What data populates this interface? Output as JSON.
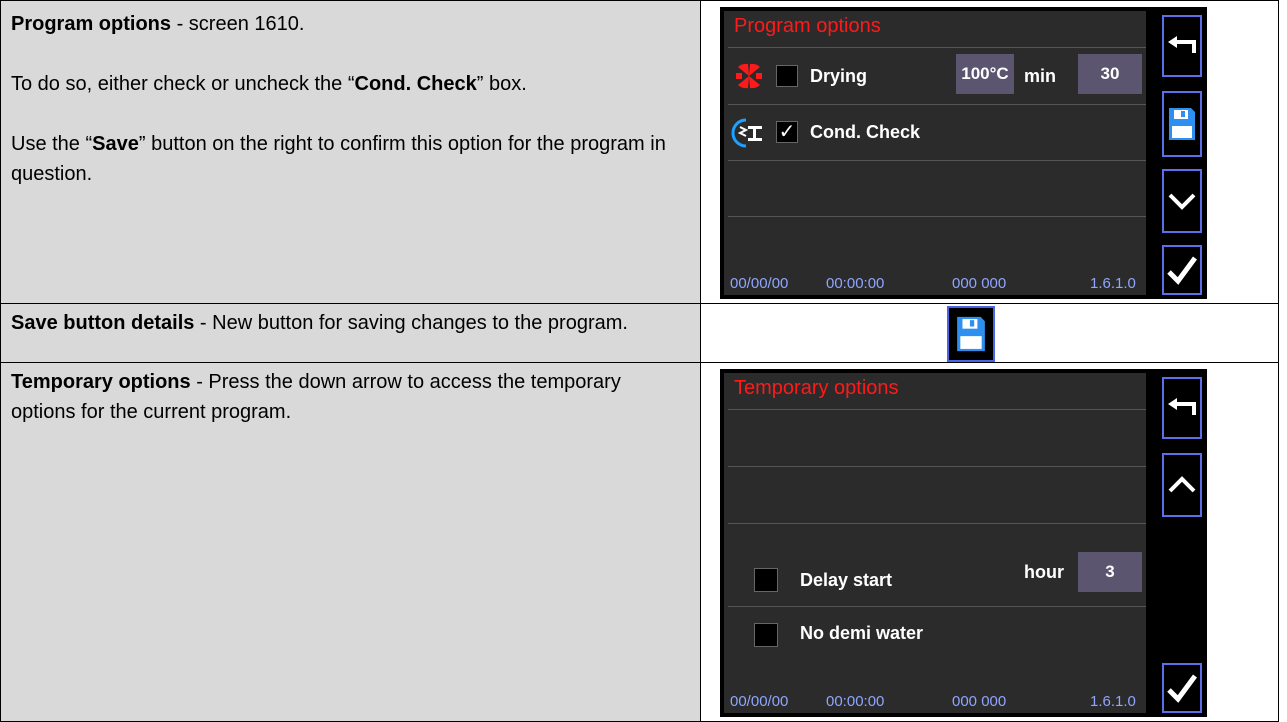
{
  "rows": [
    {
      "heading": "Program options",
      "text_1": " - screen 1610.",
      "para2_pre": "To do so, either check or uncheck the “",
      "para2_bold": "Cond. Check",
      "para2_post": "” box.",
      "para3_pre": "Use the “",
      "para3_bold": "Save",
      "para3_post": "” button on the right to confirm this option for the program in question."
    },
    {
      "heading": "Save button details",
      "text": " - New button for saving changes to the program."
    },
    {
      "heading": "Temporary options",
      "text": " - Press the down arrow to access the temporary options for the current program."
    }
  ],
  "screen1": {
    "title": "Program options",
    "drying": {
      "label": "Drying",
      "checked": false,
      "temp": "100°C",
      "unit": "min",
      "value": "30"
    },
    "cond_check": {
      "label": "Cond. Check",
      "checked": true,
      "check_mark": "✓"
    },
    "status": {
      "date": "00/00/00",
      "time": "00:00:00",
      "code": "000 000",
      "version": "1.6.1.0"
    },
    "buttons": [
      "back-arrow-icon",
      "save-disk-icon",
      "chevron-down-icon",
      "checkmark-icon"
    ]
  },
  "screen2": {
    "title": "Temporary options",
    "delay_start": {
      "label": "Delay start",
      "checked": false,
      "unit": "hour",
      "value": "3"
    },
    "no_demi": {
      "label": "No demi water",
      "checked": false
    },
    "status": {
      "date": "00/00/00",
      "time": "00:00:00",
      "code": "000 000",
      "version": "1.6.1.0"
    },
    "buttons": [
      "back-arrow-icon",
      "chevron-up-icon",
      "checkmark-icon"
    ]
  },
  "colors": {
    "title_red": "#ff1a1a",
    "button_border": "#5a6fe8",
    "status_blue": "#8fa5ff",
    "value_box": "#5b5570"
  }
}
